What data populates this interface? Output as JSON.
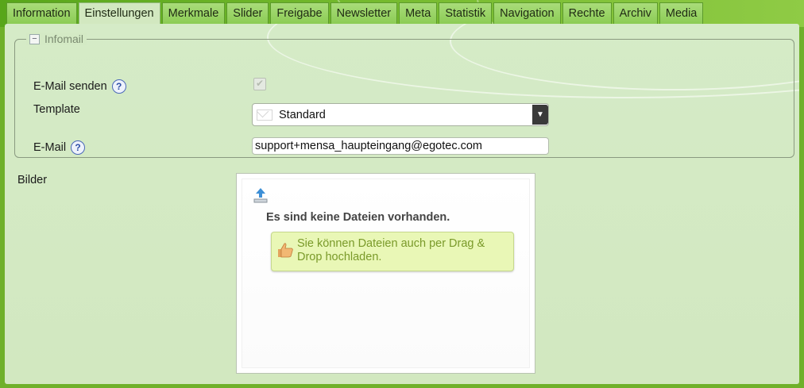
{
  "tabs": [
    {
      "label": "Information",
      "active": false
    },
    {
      "label": "Einstellungen",
      "active": true
    },
    {
      "label": "Merkmale",
      "active": false
    },
    {
      "label": "Slider",
      "active": false
    },
    {
      "label": "Freigabe",
      "active": false
    },
    {
      "label": "Newsletter",
      "active": false
    },
    {
      "label": "Meta",
      "active": false
    },
    {
      "label": "Statistik",
      "active": false
    },
    {
      "label": "Navigation",
      "active": false
    },
    {
      "label": "Rechte",
      "active": false
    },
    {
      "label": "Archiv",
      "active": false
    },
    {
      "label": "Media",
      "active": false
    }
  ],
  "infomail": {
    "legend": "Infomail",
    "collapse_symbol": "−",
    "send_label": "E-Mail senden",
    "send_checked": true,
    "template_label": "Template",
    "template_value": "Standard",
    "email_label": "E-Mail",
    "email_value": "support+mensa_haupteingang@egotec.com",
    "help_symbol": "?"
  },
  "bilder": {
    "label": "Bilder",
    "empty_text": "Es sind keine Dateien vorhanden.",
    "hint_text": "Sie können Dateien auch per Drag & Drop hochladen."
  },
  "icons": {
    "checkbox": "check-icon",
    "template": "envelope-icon",
    "dropdown": "chevron-down-icon",
    "upload": "upload-icon",
    "hint": "thumbs-up-icon"
  },
  "colors": {
    "tab_active": "#d2e8c0",
    "tab": "#8ccc55",
    "panel": "#d2e8c0",
    "hint_bg": "#e9f7b6",
    "hint_text": "#7a9a2a"
  }
}
